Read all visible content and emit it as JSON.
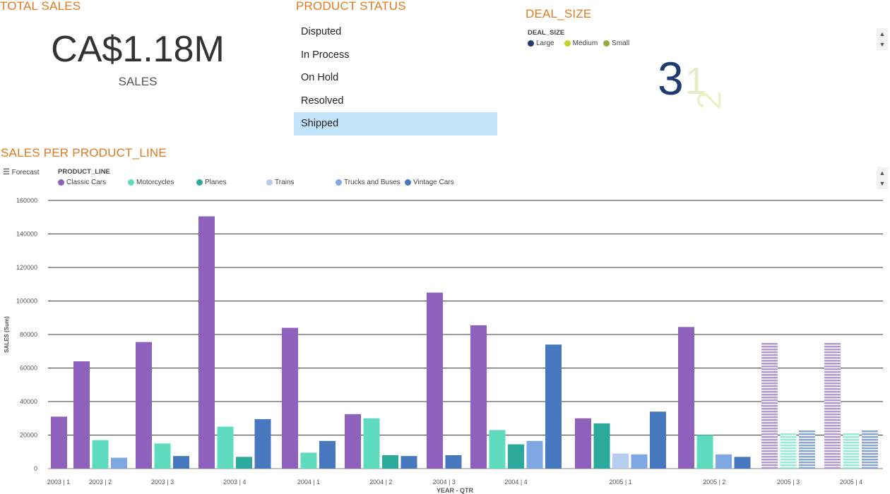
{
  "total_sales": {
    "title": "TOTAL SALES",
    "value": "CA$1.18M",
    "label": "SALES"
  },
  "product_status": {
    "title": "PRODUCT STATUS",
    "items": [
      "Disputed",
      "In Process",
      "On Hold",
      "Resolved",
      "Shipped"
    ],
    "selected": "Shipped",
    "selected_color": "#c3e3fb"
  },
  "deal_size": {
    "title": "DEAL_SIZE",
    "legend_title": "DEAL_SIZE",
    "legend": [
      {
        "name": "Large",
        "color": "#1f3b6e"
      },
      {
        "name": "Medium",
        "color": "#c5d32a"
      },
      {
        "name": "Small",
        "color": "#9ba83a"
      }
    ],
    "words": [
      {
        "text": "3",
        "color": "#1f3b6e"
      },
      {
        "text": "1",
        "color": "#e8ecc4"
      },
      {
        "text": "2",
        "color": "#eef1c6"
      }
    ]
  },
  "sales_chart_panel": {
    "title": "SALES PER PRODUCT_LINE",
    "forecast_label": "Forecast",
    "menu_icon": "hamburger-icon",
    "legend_title": "PRODUCT_LINE"
  },
  "chart_data": {
    "type": "bar",
    "xlabel": "YEAR - QTR",
    "ylabel": "SALES (Sum)",
    "ylim": [
      0,
      160000
    ],
    "yticks": [
      0,
      20000,
      40000,
      60000,
      80000,
      100000,
      120000,
      140000,
      160000
    ],
    "grid": true,
    "legend_placement": "top-left",
    "series": [
      {
        "name": "Classic Cars",
        "color": "#8e62bc"
      },
      {
        "name": "Motorcycles",
        "color": "#5fdcbf"
      },
      {
        "name": "Planes",
        "color": "#2ba99a"
      },
      {
        "name": "Trains",
        "color": "#b6cdef"
      },
      {
        "name": "Trucks and Buses",
        "color": "#7ea7e3"
      },
      {
        "name": "Vintage Cars",
        "color": "#4777bf"
      }
    ],
    "groups": [
      {
        "label": "2003 | 1",
        "forecast": false,
        "bars": [
          {
            "series": "Classic Cars",
            "value": 31000
          }
        ]
      },
      {
        "label": "2003 | 2",
        "forecast": false,
        "bars": [
          {
            "series": "Classic Cars",
            "value": 64000
          },
          {
            "series": "Motorcycles",
            "value": 17000
          },
          {
            "series": "Trucks and Buses",
            "value": 6500
          }
        ]
      },
      {
        "label": "2003 | 3",
        "forecast": false,
        "bars": [
          {
            "series": "Classic Cars",
            "value": 75500
          },
          {
            "series": "Motorcycles",
            "value": 15000
          },
          {
            "series": "Vintage Cars",
            "value": 7500
          }
        ]
      },
      {
        "label": "2003 | 4",
        "forecast": false,
        "bars": [
          {
            "series": "Classic Cars",
            "value": 150500
          },
          {
            "series": "Motorcycles",
            "value": 25000
          },
          {
            "series": "Planes",
            "value": 7000
          },
          {
            "series": "Vintage Cars",
            "value": 29500
          }
        ]
      },
      {
        "label": "2004 | 1",
        "forecast": false,
        "bars": [
          {
            "series": "Classic Cars",
            "value": 84000
          },
          {
            "series": "Motorcycles",
            "value": 9500
          },
          {
            "series": "Vintage Cars",
            "value": 16500
          }
        ]
      },
      {
        "label": "2004 | 2",
        "forecast": false,
        "bars": [
          {
            "series": "Classic Cars",
            "value": 32500
          },
          {
            "series": "Motorcycles",
            "value": 30000
          },
          {
            "series": "Planes",
            "value": 8000
          },
          {
            "series": "Vintage Cars",
            "value": 7500
          }
        ]
      },
      {
        "label": "2004 | 3",
        "forecast": false,
        "bars": [
          {
            "series": "Classic Cars",
            "value": 105000
          },
          {
            "series": "Vintage Cars",
            "value": 8000
          }
        ]
      },
      {
        "label": "2004 | 4",
        "forecast": false,
        "bars": [
          {
            "series": "Classic Cars",
            "value": 85500
          },
          {
            "series": "Motorcycles",
            "value": 23000
          },
          {
            "series": "Planes",
            "value": 14500
          },
          {
            "series": "Trucks and Buses",
            "value": 16500
          },
          {
            "series": "Vintage Cars",
            "value": 74000
          }
        ]
      },
      {
        "label": "2005 | 1",
        "forecast": false,
        "bars": [
          {
            "series": "Classic Cars",
            "value": 30000
          },
          {
            "series": "Planes",
            "value": 27000
          },
          {
            "series": "Trains",
            "value": 9000
          },
          {
            "series": "Trucks and Buses",
            "value": 8500
          },
          {
            "series": "Vintage Cars",
            "value": 34000
          }
        ]
      },
      {
        "label": "2005 | 2",
        "forecast": false,
        "bars": [
          {
            "series": "Classic Cars",
            "value": 84500
          },
          {
            "series": "Motorcycles",
            "value": 20000
          },
          {
            "series": "Trucks and Buses",
            "value": 8500
          },
          {
            "series": "Vintage Cars",
            "value": 7000
          }
        ]
      },
      {
        "label": "2005 | 3",
        "forecast": true,
        "bars": [
          {
            "series": "Classic Cars",
            "value": 75000
          },
          {
            "series": "Motorcycles",
            "value": 21000
          },
          {
            "series": "Vintage Cars",
            "value": 23000
          }
        ]
      },
      {
        "label": "2005 | 4",
        "forecast": true,
        "bars": [
          {
            "series": "Classic Cars",
            "value": 75000
          },
          {
            "series": "Motorcycles",
            "value": 21000
          },
          {
            "series": "Vintage Cars",
            "value": 23000
          }
        ]
      }
    ]
  }
}
